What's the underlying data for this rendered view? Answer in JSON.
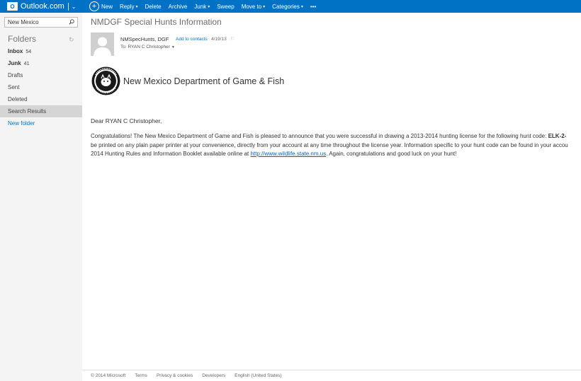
{
  "topbar": {
    "brand": "Outlook.com",
    "commands": {
      "new": "New",
      "reply": "Reply",
      "delete": "Delete",
      "archive": "Archive",
      "junk": "Junk",
      "sweep": "Sweep",
      "moveto": "Move to",
      "categories": "Categories",
      "more": "•••"
    }
  },
  "sidebar": {
    "search_value": "New Mexico",
    "folders_heading": "Folders",
    "folders": [
      {
        "label": "Inbox",
        "count": "54"
      },
      {
        "label": "Junk",
        "count": "41"
      },
      {
        "label": "Drafts"
      },
      {
        "label": "Sent"
      },
      {
        "label": "Deleted"
      },
      {
        "label": "Search Results"
      },
      {
        "label": "New folder"
      }
    ]
  },
  "message": {
    "subject": "NMDGF Special Hunts Information",
    "sender": "NMSpecHunts, DGF",
    "add_contacts": "Add to contacts",
    "date": "4/19/13",
    "to": "To: RYAN C Christopher",
    "org_name": "New Mexico Department of Game & Fish",
    "seal_text": "NEW MEXICO GAME & FISH",
    "greeting": "Dear RYAN C Christopher,",
    "line1_before": "Congratulations! The New Mexico Department of Game and Fish is pleased to announce that you were successful in drawing a 2013-2014 hunting license for the following hunt code: ",
    "line1_code": "ELK-2-",
    "line2": "be printed on any plain paper printer at your convenience, directly from your account at any time throughout the license year. Information specific to your hunt code can be found in your accou",
    "line3_before": "2014 Hunting Rules and Information Booklet available online at ",
    "line3_link": "http://www.wildlife.state.nm.us",
    "line3_after": ". Again, congratulations and good luck on your hunt!"
  },
  "footer": {
    "copyright": "© 2014 Microsoft",
    "terms": "Terms",
    "privacy": "Privacy & cookies",
    "developers": "Developers",
    "language": "English (United States)"
  },
  "colors": {
    "brand_blue": "#0072c6",
    "sidebar_bg": "#f4f4f4",
    "selected_folder": "#d5d5d5"
  }
}
